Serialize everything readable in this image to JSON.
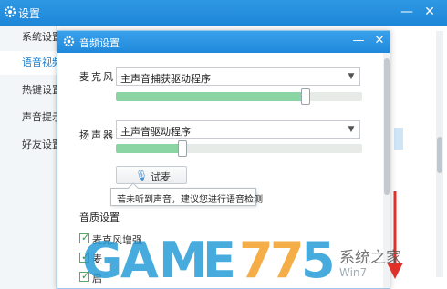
{
  "outer_window": {
    "title": "设置",
    "sidebar": {
      "items": [
        {
          "label": "系统设置"
        },
        {
          "label": "语音视频"
        },
        {
          "label": "热键设置"
        },
        {
          "label": "声音提示"
        },
        {
          "label": "好友设置"
        }
      ],
      "active_index": 1
    }
  },
  "dialog": {
    "title": "音频设置",
    "microphone": {
      "label": "麦克风",
      "device": "主声音捕获驱动程序",
      "volume_level": 0.77
    },
    "speaker": {
      "label": "扬声器",
      "device": "主声音驱动程序",
      "volume_level": 0.27
    },
    "test_button": {
      "label": "试麦",
      "icon": "microphone-icon"
    },
    "tooltip": "若未听到声音，建议您进行语音检测",
    "quality_section": {
      "title": "音质设置",
      "options": [
        {
          "label": "麦克风增强",
          "checked": true
        },
        {
          "label": "麦",
          "checked": true
        },
        {
          "label": "启",
          "checked": true
        }
      ]
    }
  },
  "watermark": {
    "letters": [
      "G",
      "A",
      "M",
      "E",
      "7",
      "7",
      "5"
    ],
    "site": "系统之家",
    "sub": "Win7"
  },
  "colors": {
    "titlebar": "#1f88da",
    "slider_fill": "#8bd4a4",
    "accent": "#1b7fd0",
    "watermark_blue": "#1f9ad6",
    "watermark_orange": "#f39c1f"
  }
}
